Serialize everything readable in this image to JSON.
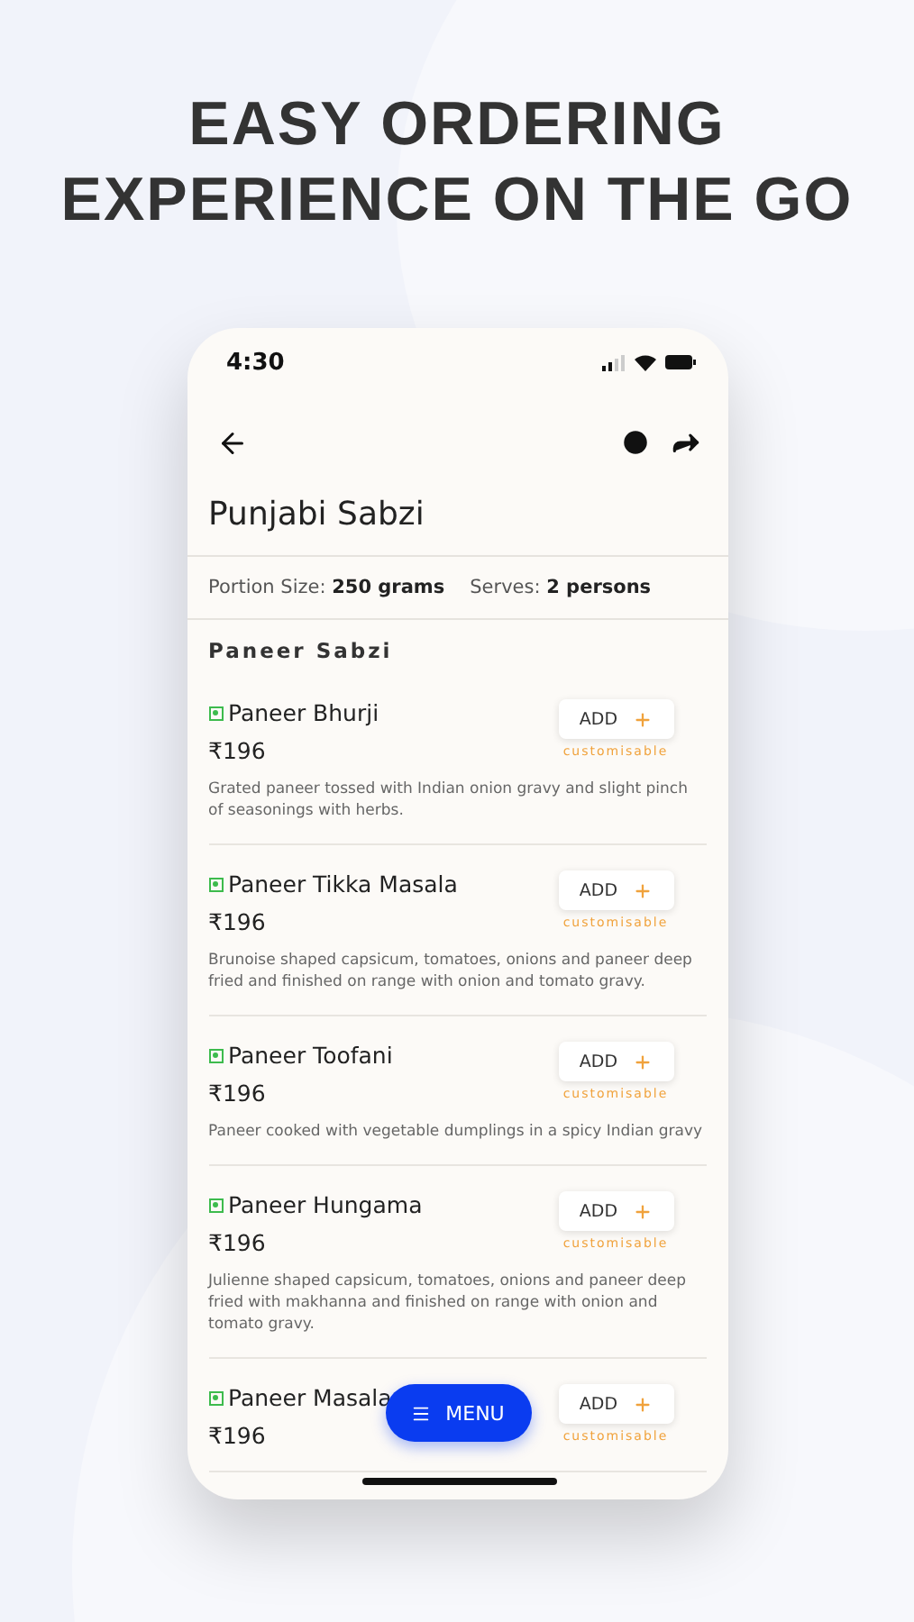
{
  "headline": [
    "EASY ORDERING",
    "EXPERIENCE ON THE GO"
  ],
  "status_bar": {
    "time": "4:30"
  },
  "header": {
    "title": "Punjabi Sabzi"
  },
  "info": [
    {
      "label": "Portion Size: ",
      "value": "250 grams"
    },
    {
      "label": "Serves: ",
      "value": "2 persons"
    }
  ],
  "section": "Paneer Sabzi",
  "items": [
    {
      "name": "Paneer Bhurji",
      "price": "₹196",
      "button": "ADD",
      "note": "customisable",
      "description": "Grated paneer tossed with Indian onion gravy and slight pinch of seasonings with herbs."
    },
    {
      "name": "Paneer Tikka Masala",
      "price": "₹196",
      "button": "ADD",
      "note": "customisable",
      "description": "Brunoise shaped capsicum, tomatoes, onions and paneer deep fried and finished on range with onion and tomato gravy."
    },
    {
      "name": "Paneer Toofani",
      "price": "₹196",
      "button": "ADD",
      "note": "customisable",
      "description": "Paneer cooked with vegetable dumplings in a spicy Indian gravy"
    },
    {
      "name": "Paneer Hungama",
      "price": "₹196",
      "button": "ADD",
      "note": "customisable",
      "description": "Julienne shaped capsicum, tomatoes, onions and paneer deep fried with makhanna and finished on range with onion and tomato gravy."
    },
    {
      "name": "Paneer Masala",
      "price": "₹196",
      "button": "ADD",
      "note": "customisable"
    }
  ],
  "menu_button": "MENU"
}
